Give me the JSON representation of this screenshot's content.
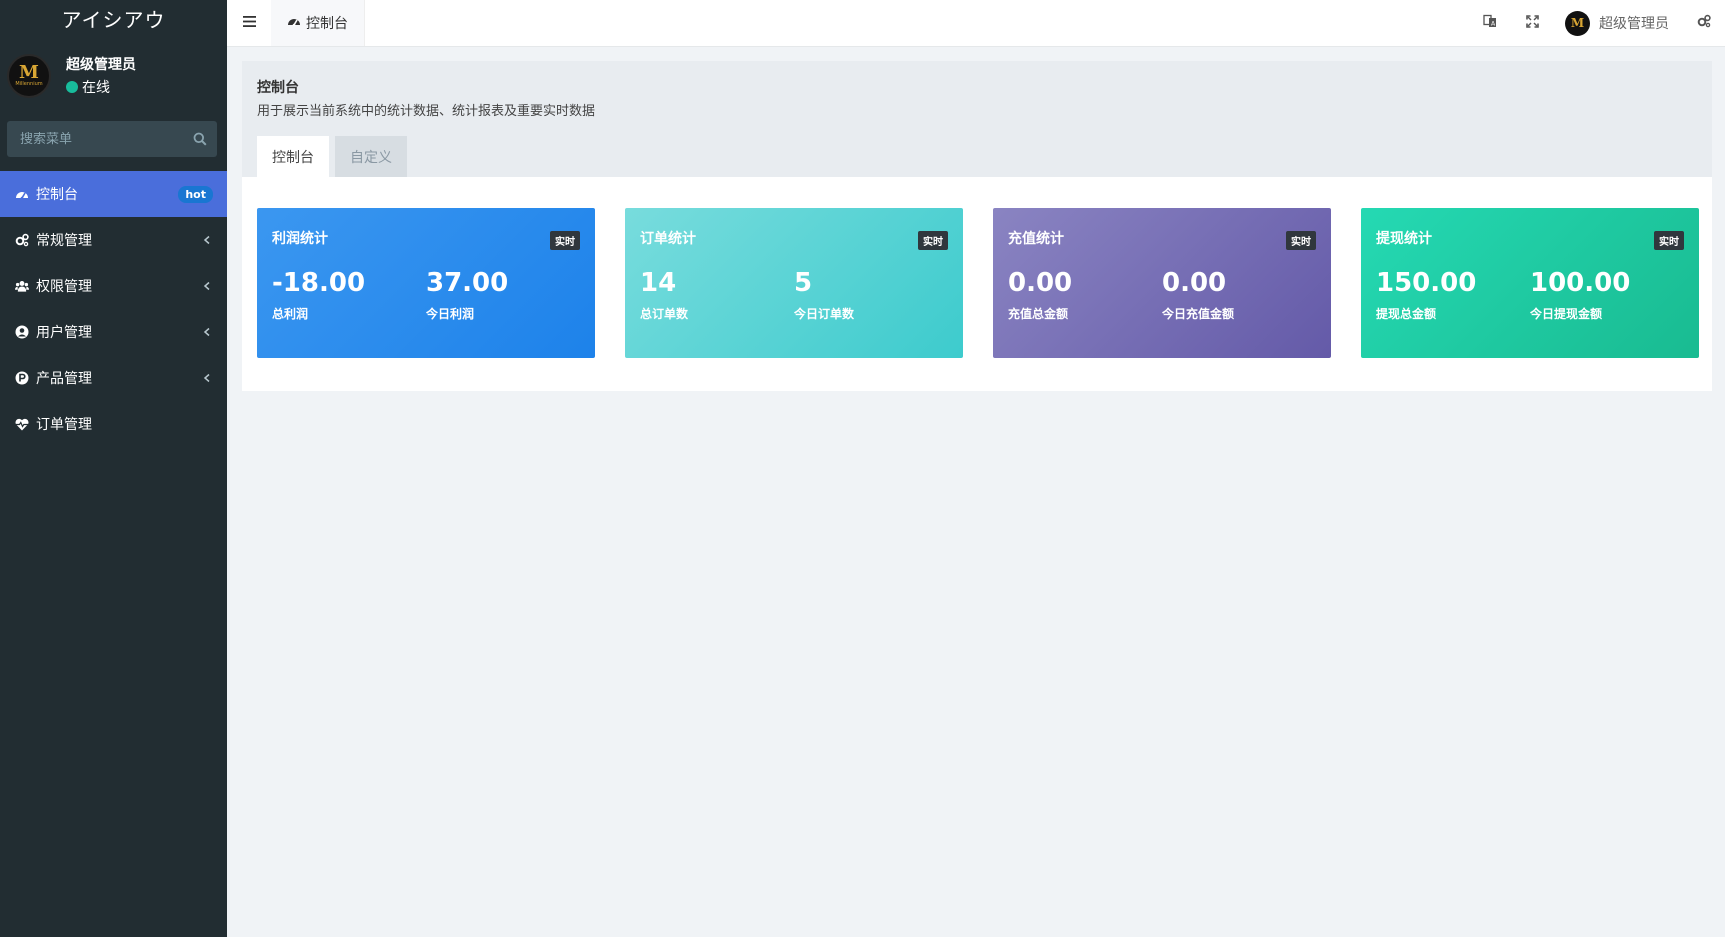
{
  "brand": {
    "title": "アイシアウ"
  },
  "user": {
    "name": "超级管理员",
    "status": "在线",
    "avatar_letter": "M",
    "avatar_text": "Millennium"
  },
  "search": {
    "placeholder": "搜索菜单"
  },
  "menu": {
    "items": [
      {
        "label": "控制台",
        "badge": "hot",
        "icon": "dashboard-icon",
        "active": true
      },
      {
        "label": "常规管理",
        "icon": "cogs-icon"
      },
      {
        "label": "权限管理",
        "icon": "group-icon"
      },
      {
        "label": "用户管理",
        "icon": "user-circle-icon"
      },
      {
        "label": "产品管理",
        "icon": "product-p-icon"
      },
      {
        "label": "订单管理",
        "icon": "heartbeat-icon"
      }
    ]
  },
  "header": {
    "tab_label": "控制台",
    "user_name": "超级管理员",
    "avatar_letter": "M"
  },
  "page": {
    "title": "控制台",
    "description": "用于展示当前系统中的统计数据、统计报表及重要实时数据",
    "tabs": [
      "控制台",
      "自定义"
    ]
  },
  "cards": [
    {
      "title": "利润统计",
      "tag": "实时",
      "stats": [
        {
          "value": "-18.00",
          "label": "总利润"
        },
        {
          "value": "37.00",
          "label": "今日利润"
        }
      ]
    },
    {
      "title": "订单统计",
      "tag": "实时",
      "stats": [
        {
          "value": "14",
          "label": "总订单数"
        },
        {
          "value": "5",
          "label": "今日订单数"
        }
      ]
    },
    {
      "title": "充值统计",
      "tag": "实时",
      "stats": [
        {
          "value": "0.00",
          "label": "充值总金额"
        },
        {
          "value": "0.00",
          "label": "今日充值金额"
        }
      ]
    },
    {
      "title": "提现统计",
      "tag": "实时",
      "stats": [
        {
          "value": "150.00",
          "label": "提现总金额"
        },
        {
          "value": "100.00",
          "label": "今日提现金额"
        }
      ]
    }
  ]
}
